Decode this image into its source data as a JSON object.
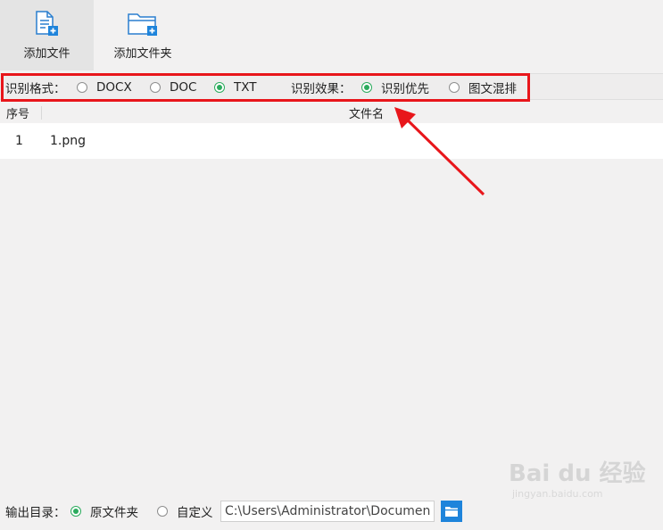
{
  "toolbar": {
    "add_file": {
      "label": "添加文件",
      "icon": "add-file-icon"
    },
    "add_folder": {
      "label": "添加文件夹",
      "icon": "add-folder-icon"
    }
  },
  "options": {
    "format_label": "识别格式：",
    "formats": [
      {
        "label": "DOCX",
        "checked": false
      },
      {
        "label": "DOC",
        "checked": false
      },
      {
        "label": "TXT",
        "checked": true
      }
    ],
    "effect_label": "识别效果：",
    "effects": [
      {
        "label": "识别优先",
        "checked": true
      },
      {
        "label": "图文混排",
        "checked": false
      }
    ]
  },
  "table": {
    "columns": {
      "seq": "序号",
      "name": "文件名"
    },
    "rows": [
      {
        "seq": "1",
        "name": "1.png"
      }
    ]
  },
  "footer": {
    "output_label": "输出目录：",
    "options": [
      {
        "label": "原文件夹",
        "checked": true
      },
      {
        "label": "自定义",
        "checked": false
      }
    ],
    "path_value": "C:\\Users\\Administrator\\Documents"
  },
  "watermark": {
    "main": "Bai du 经验",
    "sub": "jingyan.baidu.com"
  },
  "colors": {
    "accent_green": "#2bab5d",
    "highlight_red": "#e8161b",
    "icon_blue": "#1e84db"
  }
}
